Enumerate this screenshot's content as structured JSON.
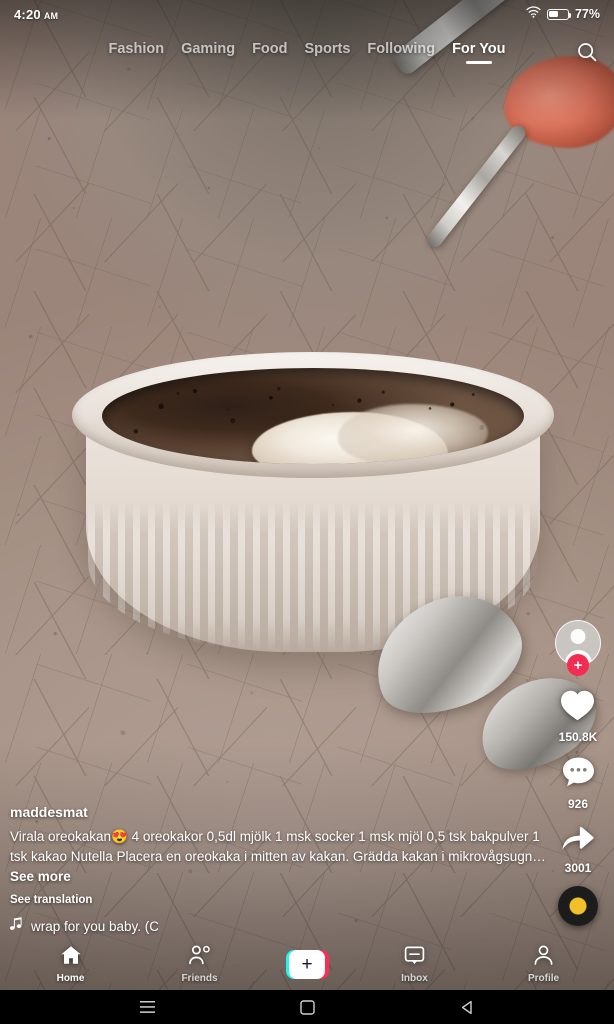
{
  "status_bar": {
    "time": "4:20",
    "am_pm": "AM",
    "battery_percent": "77%",
    "wifi_icon": "wifi-icon",
    "battery_icon": "battery-icon"
  },
  "top_nav": {
    "tabs": [
      {
        "label": "Fashion",
        "active": false
      },
      {
        "label": "Gaming",
        "active": false
      },
      {
        "label": "Food",
        "active": false
      },
      {
        "label": "Sports",
        "active": false
      },
      {
        "label": "Following",
        "active": false
      },
      {
        "label": "For You",
        "active": true
      }
    ],
    "search_icon": "search-icon"
  },
  "action_rail": {
    "avatar_icon": "avatar-placeholder-icon",
    "follow_badge": "+",
    "like": {
      "icon": "heart-icon",
      "count": "150.8K"
    },
    "comment": {
      "icon": "comment-bubble-icon",
      "count": "926"
    },
    "share": {
      "icon": "share-arrow-icon",
      "count": "3001"
    },
    "music_disc_icon": "vinyl-record-icon"
  },
  "caption": {
    "username": "maddesmat",
    "description": "Virala oreokakan😍 4 oreokakor 0,5dl mjölk 1 msk socker 1 msk mjöl 0,5 tsk bakpulver 1 tsk kakao Nutella Placera en oreokaka i mitten av kakan. Grädda kakan i mikrovågsugn…",
    "see_more": "See more",
    "see_translation": "See translation",
    "music_note_icon": "music-note-icon",
    "music_title": "wrap for you baby. (Cc"
  },
  "bottom_nav": {
    "items": [
      {
        "label": "Home",
        "icon": "home-icon",
        "active": true
      },
      {
        "label": "Friends",
        "icon": "friends-icon",
        "active": false
      },
      {
        "label": "Inbox",
        "icon": "inbox-icon",
        "active": false
      },
      {
        "label": "Profile",
        "icon": "profile-icon",
        "active": false
      }
    ],
    "create_button": {
      "icon": "plus-icon",
      "label": "+"
    }
  },
  "system_nav": {
    "recents_icon": "recents-icon",
    "home_icon": "system-home-icon",
    "back_icon": "back-icon"
  },
  "colors": {
    "accent_pink": "#FE2C55",
    "accent_cyan": "#25F4EE",
    "follow_badge": "#F42C51",
    "disc_center": "#F2C029"
  }
}
